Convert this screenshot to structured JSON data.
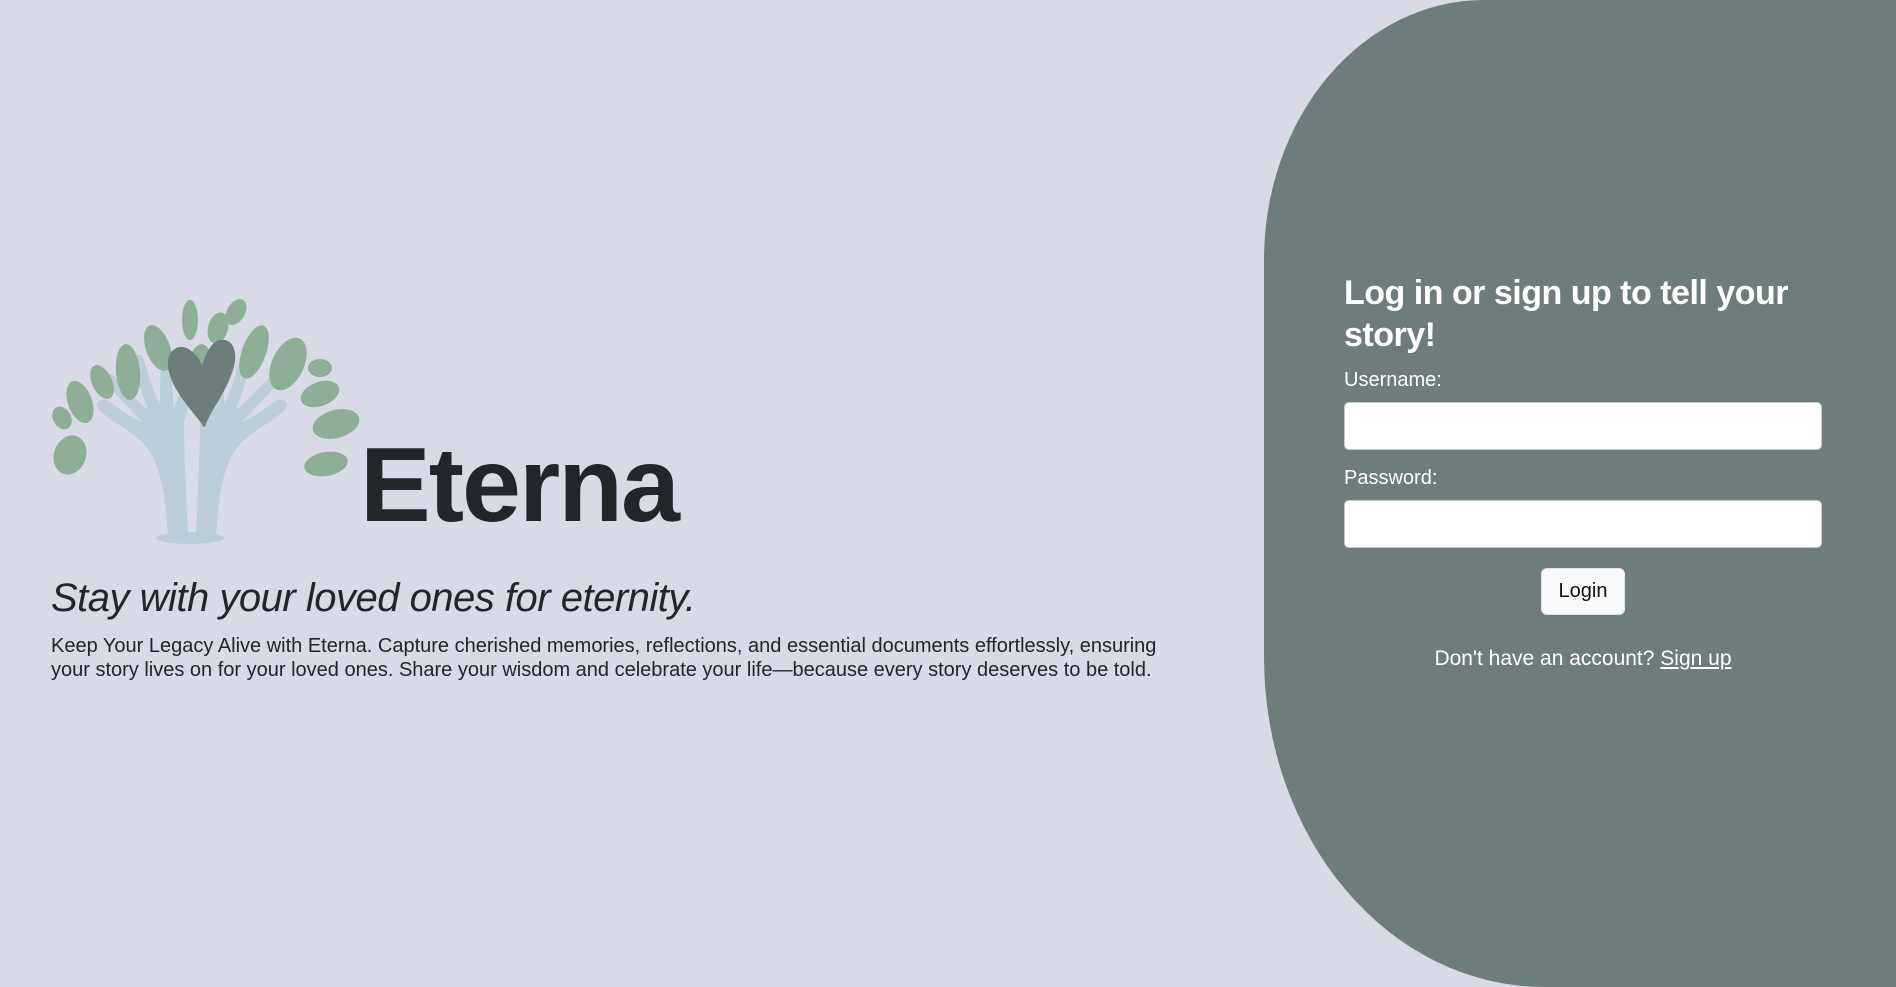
{
  "brand": {
    "name": "Eterna",
    "tagline": "Stay with your loved ones for eternity.",
    "description": "Keep Your Legacy Alive with Eterna. Capture cherished memories, reflections, and essential documents effortlessly, ensuring your story lives on for your loved ones. Share your wisdom and celebrate your life—because every story deserves to be told.",
    "logo_icon": "tree-hands-heart-icon"
  },
  "login": {
    "title": "Log in or sign up to tell your story!",
    "username_label": "Username:",
    "username_value": "",
    "password_label": "Password:",
    "password_value": "",
    "login_button": "Login",
    "signup_prompt": "Don't have an account?",
    "signup_link": "Sign up"
  },
  "colors": {
    "background": "#d8dae5",
    "panel": "#6f7c7c",
    "text_dark": "#22252a",
    "leaf_green": "#8fae98",
    "hands_blue": "#bccfd9",
    "heart_gray": "#6f7c7c"
  }
}
